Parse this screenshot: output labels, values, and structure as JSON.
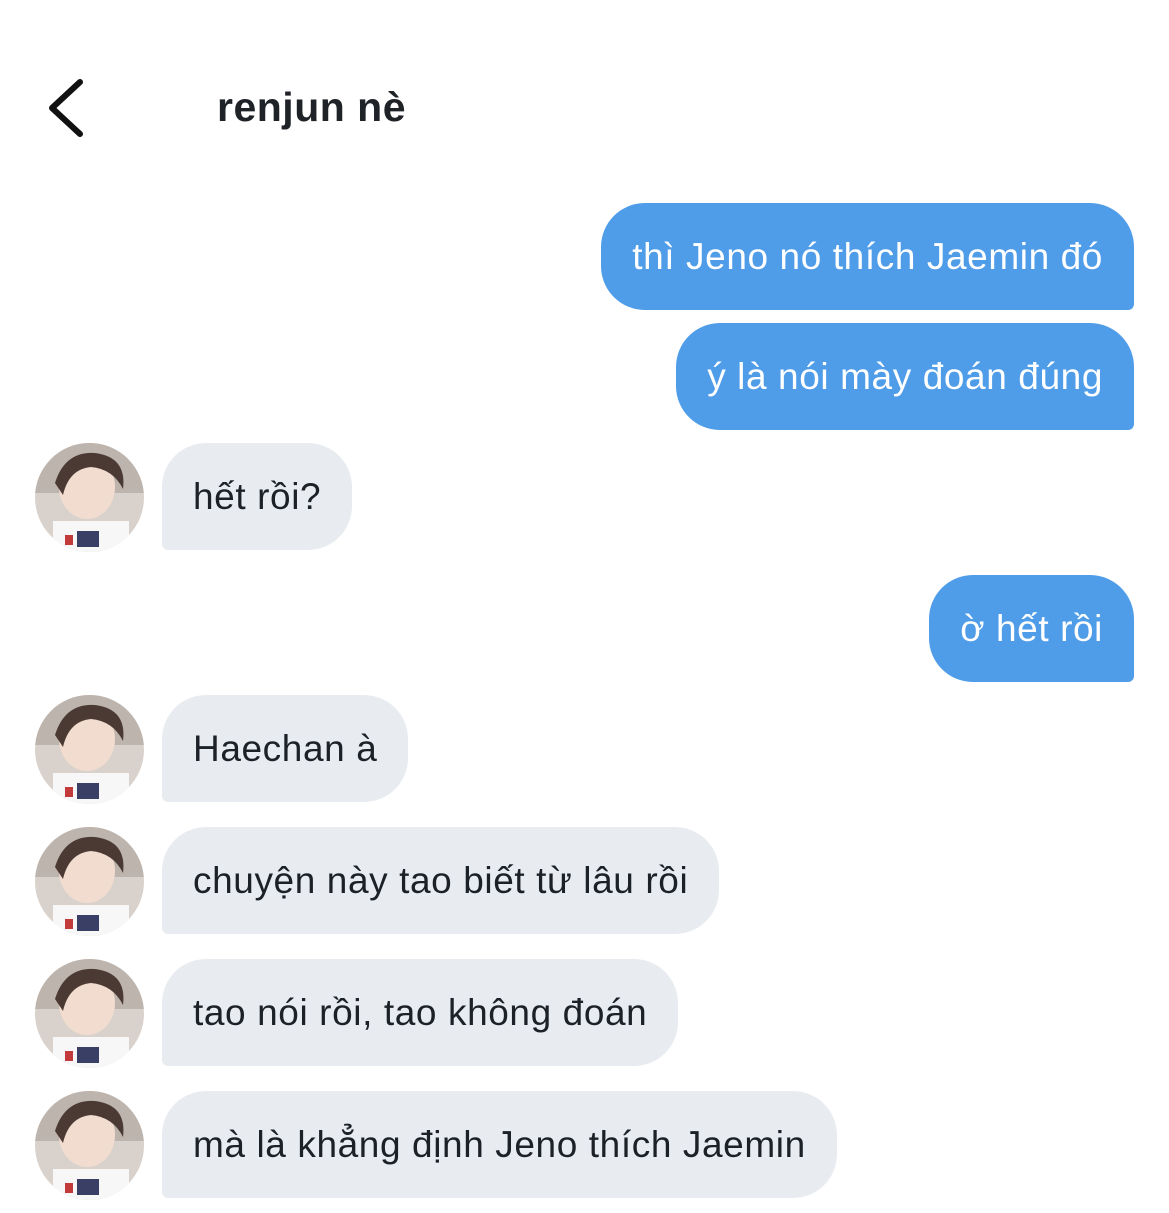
{
  "header": {
    "back_icon": "chevron-left-icon",
    "title": "renjun nè"
  },
  "messages": [
    {
      "sender": "me",
      "text": "thì Jeno nó thích Jaemin đó"
    },
    {
      "sender": "me",
      "text": "ý là nói mày đoán đúng"
    },
    {
      "sender": "them",
      "text": "hết rồi?"
    },
    {
      "sender": "me",
      "text": "ờ hết rồi"
    },
    {
      "sender": "them",
      "text": "Haechan à"
    },
    {
      "sender": "them",
      "text": "chuyện này tao biết từ lâu rồi"
    },
    {
      "sender": "them",
      "text": "tao nói rồi, tao không đoán"
    },
    {
      "sender": "them",
      "text": "mà là khẳng định Jeno thích Jaemin"
    }
  ],
  "colors": {
    "outgoing_bubble": "#4f9ce8",
    "incoming_bubble": "#e8ecf0",
    "text_dark": "#1c2127"
  }
}
